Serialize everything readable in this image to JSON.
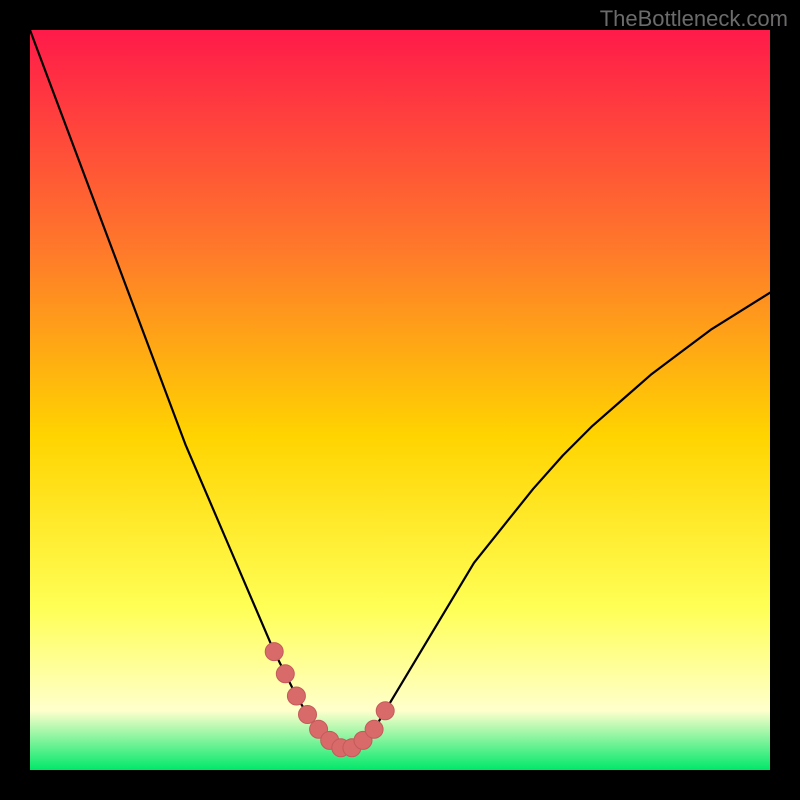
{
  "watermark": "TheBottleneck.com",
  "colors": {
    "frame_bg": "#000000",
    "curve": "#000000",
    "marker_fill": "#d86a6a",
    "marker_stroke": "#c45a5a",
    "gradient_top": "#ff1a4a",
    "gradient_mid1": "#ff7a2a",
    "gradient_mid2": "#ffd400",
    "gradient_mid3": "#ffff55",
    "gradient_bottom_pale": "#ffffcc",
    "gradient_green": "#00e86a"
  },
  "chart_data": {
    "type": "line",
    "title": "",
    "xlabel": "",
    "ylabel": "",
    "xlim": [
      0,
      100
    ],
    "ylim": [
      0,
      100
    ],
    "curve": {
      "name": "bottleneck-curve",
      "x": [
        0,
        3,
        6,
        9,
        12,
        15,
        18,
        21,
        24,
        27,
        30,
        33,
        34.5,
        36,
        37.5,
        39,
        40.5,
        42,
        43.5,
        45,
        46.5,
        48,
        51,
        54,
        57,
        60,
        64,
        68,
        72,
        76,
        80,
        84,
        88,
        92,
        96,
        100
      ],
      "y": [
        100,
        92,
        84,
        76,
        68,
        60,
        52,
        44,
        37,
        30,
        23,
        16,
        13,
        10,
        7.5,
        5.5,
        4,
        3,
        3,
        4,
        5.5,
        8,
        13,
        18,
        23,
        28,
        33,
        38,
        42.5,
        46.5,
        50,
        53.5,
        56.5,
        59.5,
        62,
        64.5
      ]
    },
    "markers": {
      "name": "min-region",
      "x": [
        33,
        34.5,
        36,
        37.5,
        39,
        40.5,
        42,
        43.5,
        45,
        46.5,
        48
      ],
      "y": [
        16,
        13,
        10,
        7.5,
        5.5,
        4,
        3,
        3,
        4,
        5.5,
        8
      ]
    }
  }
}
